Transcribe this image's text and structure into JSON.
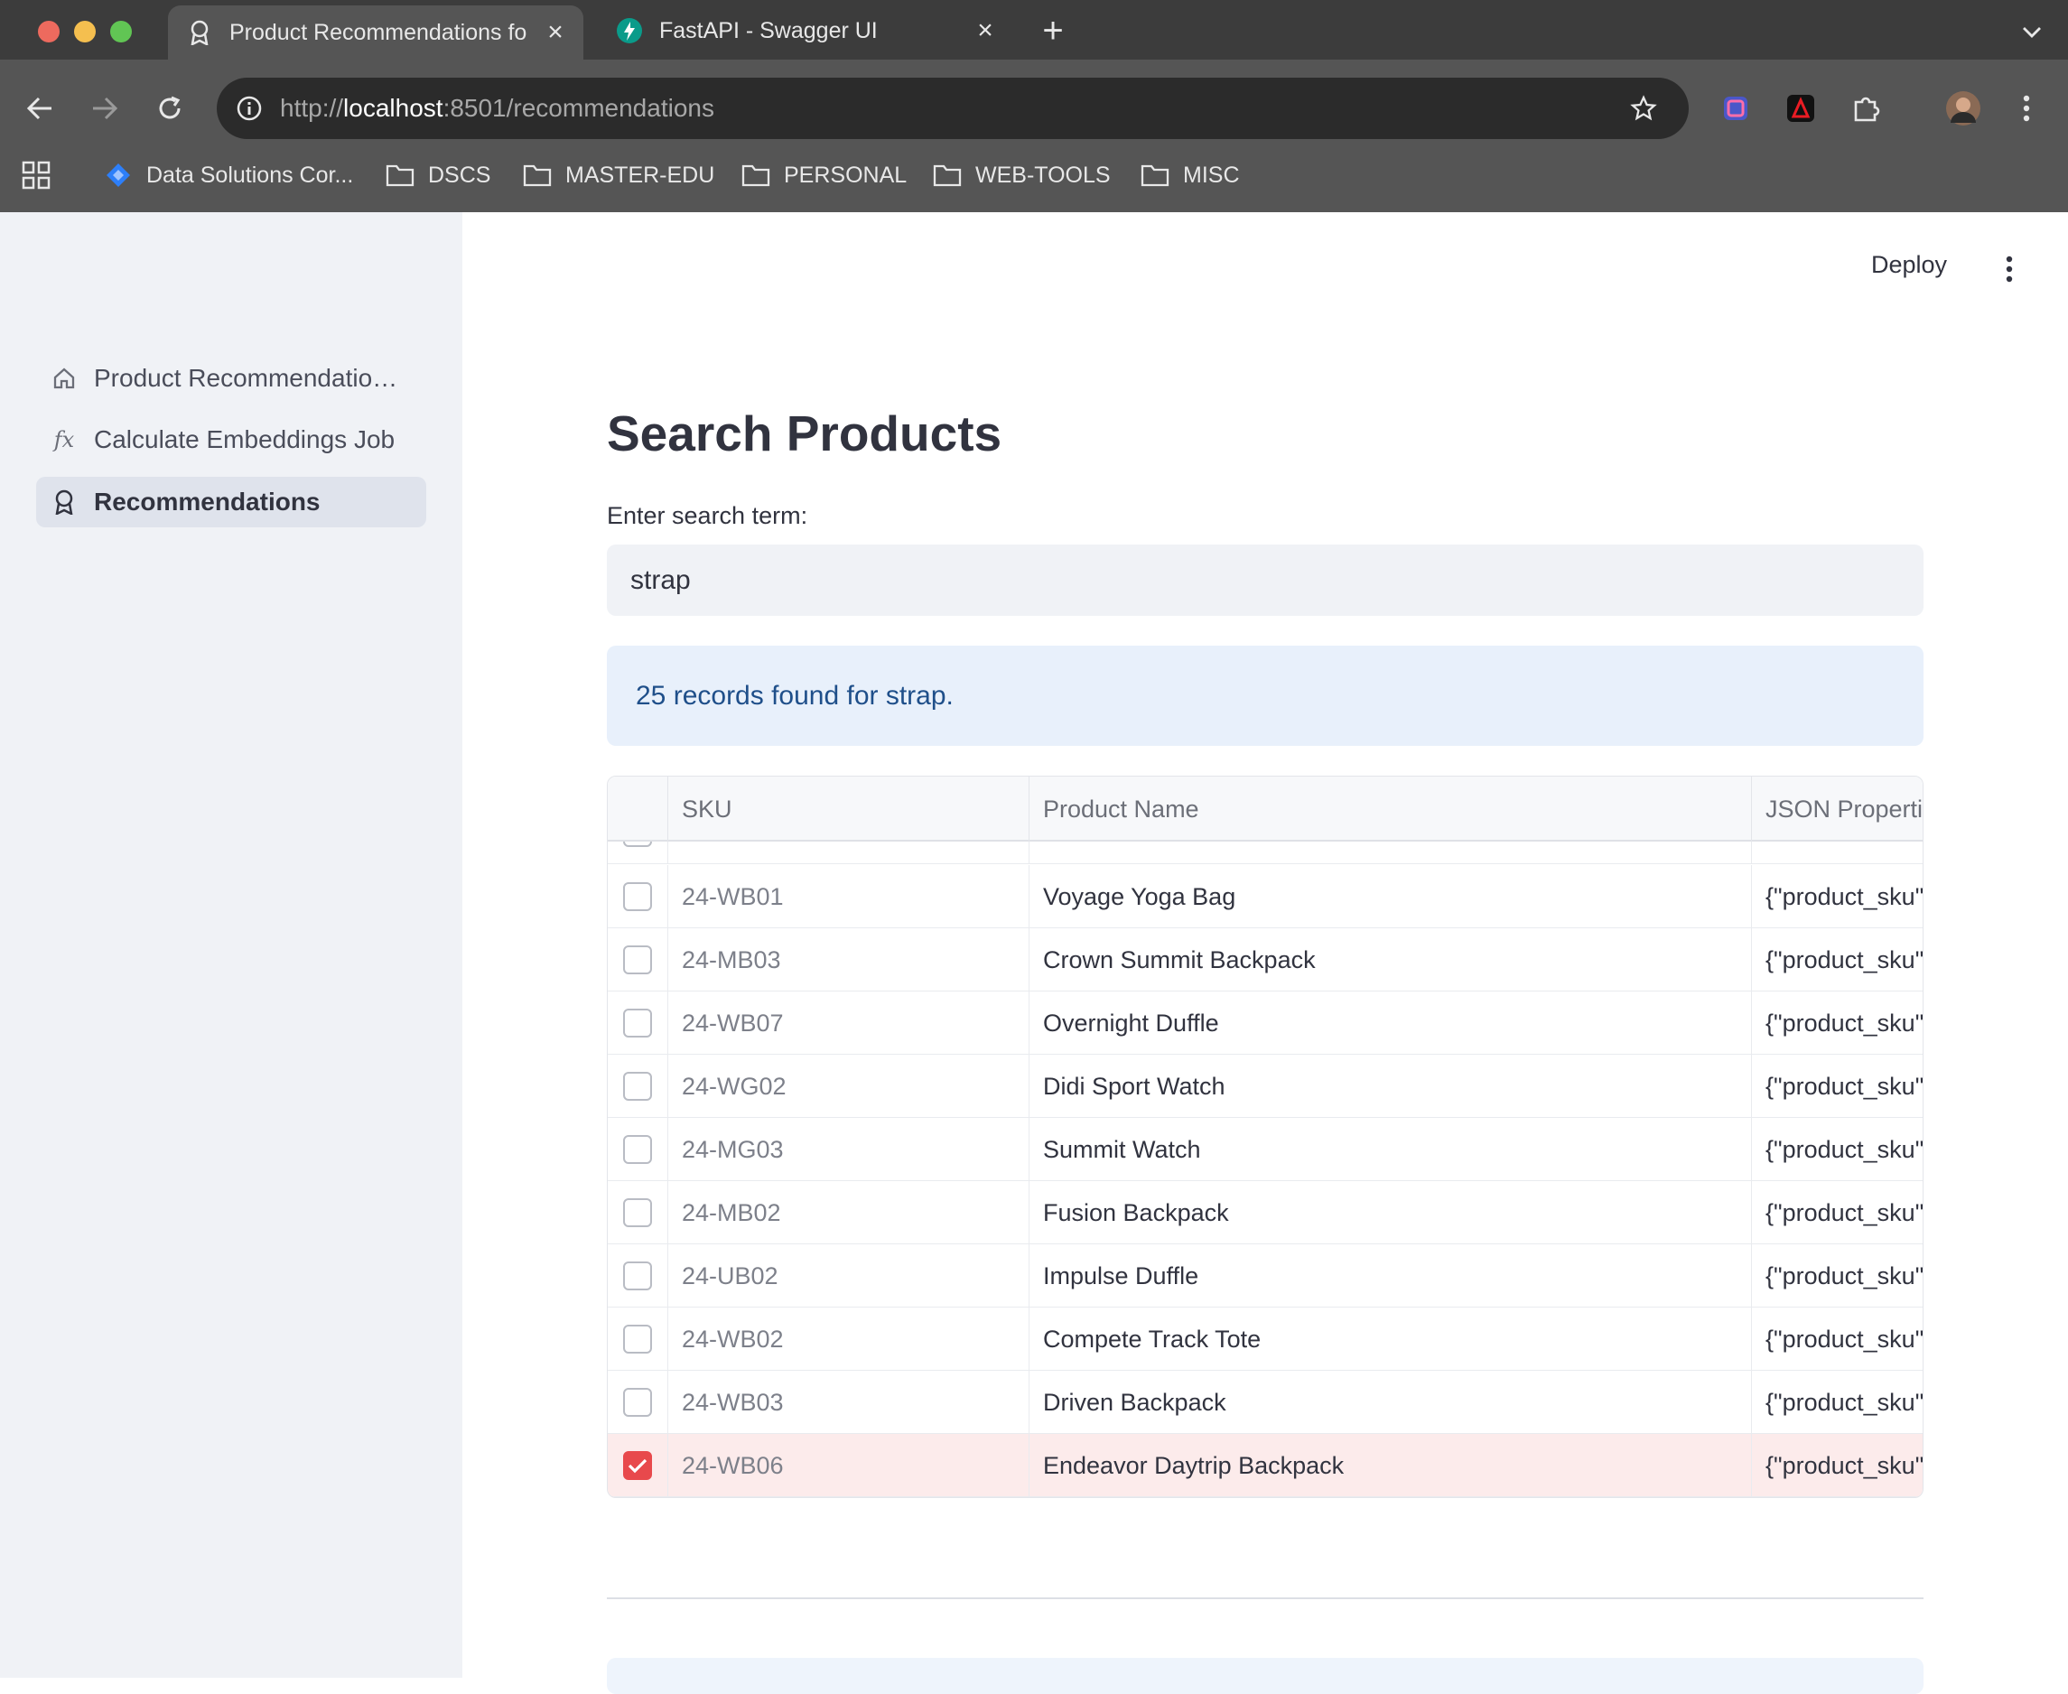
{
  "browser": {
    "tabs": [
      {
        "title": "Product Recommendations fo",
        "icon": "award-icon"
      },
      {
        "title": "FastAPI - Swagger UI",
        "icon": "fastapi-icon"
      }
    ],
    "url_prefix": "http://",
    "url_host": "localhost",
    "url_rest": ":8501/recommendations",
    "bookmarks": [
      {
        "label": "Data Solutions Cor...",
        "icon": "diamond-icon"
      },
      {
        "label": "DSCS",
        "icon": "folder-icon"
      },
      {
        "label": "MASTER-EDU",
        "icon": "folder-icon"
      },
      {
        "label": "PERSONAL",
        "icon": "folder-icon"
      },
      {
        "label": "WEB-TOOLS",
        "icon": "folder-icon"
      },
      {
        "label": "MISC",
        "icon": "folder-icon"
      }
    ]
  },
  "sidebar": {
    "items": [
      {
        "label": "Product Recommendations for Retail",
        "icon": "home-icon",
        "selected": false
      },
      {
        "label": "Calculate Embeddings Job",
        "icon": "function-icon",
        "selected": false
      },
      {
        "label": "Recommendations",
        "icon": "award-icon",
        "selected": true
      }
    ]
  },
  "header": {
    "deploy_label": "Deploy"
  },
  "main": {
    "title": "Search Products",
    "search_label": "Enter search term:",
    "search_value": "strap",
    "result_message": "25 records found for strap."
  },
  "table": {
    "columns": [
      "",
      "SKU",
      "Product Name",
      "JSON Propertie"
    ],
    "rows": [
      {
        "sku": "24-WB01",
        "name": "Voyage Yoga Bag",
        "json": "{\"product_sku\"",
        "checked": false
      },
      {
        "sku": "24-MB03",
        "name": "Crown Summit Backpack",
        "json": "{\"product_sku\"",
        "checked": false
      },
      {
        "sku": "24-WB07",
        "name": "Overnight Duffle",
        "json": "{\"product_sku\"",
        "checked": false
      },
      {
        "sku": "24-WG02",
        "name": "Didi Sport Watch",
        "json": "{\"product_sku\"",
        "checked": false
      },
      {
        "sku": "24-MG03",
        "name": "Summit Watch",
        "json": "{\"product_sku\"",
        "checked": false
      },
      {
        "sku": "24-MB02",
        "name": "Fusion Backpack",
        "json": "{\"product_sku\"",
        "checked": false
      },
      {
        "sku": "24-UB02",
        "name": "Impulse Duffle",
        "json": "{\"product_sku\"",
        "checked": false
      },
      {
        "sku": "24-WB02",
        "name": "Compete Track Tote",
        "json": "{\"product_sku\"",
        "checked": false
      },
      {
        "sku": "24-WB03",
        "name": "Driven Backpack",
        "json": "{\"product_sku\"",
        "checked": false
      },
      {
        "sku": "24-WB06",
        "name": "Endeavor Daytrip Backpack",
        "json": "{\"product_sku\"",
        "checked": true
      }
    ]
  },
  "colors": {
    "accent": "#e8494c",
    "info_bg": "#e8f0fb",
    "info_text": "#1f4f8a",
    "sidebar_bg": "#f0f2f6"
  }
}
